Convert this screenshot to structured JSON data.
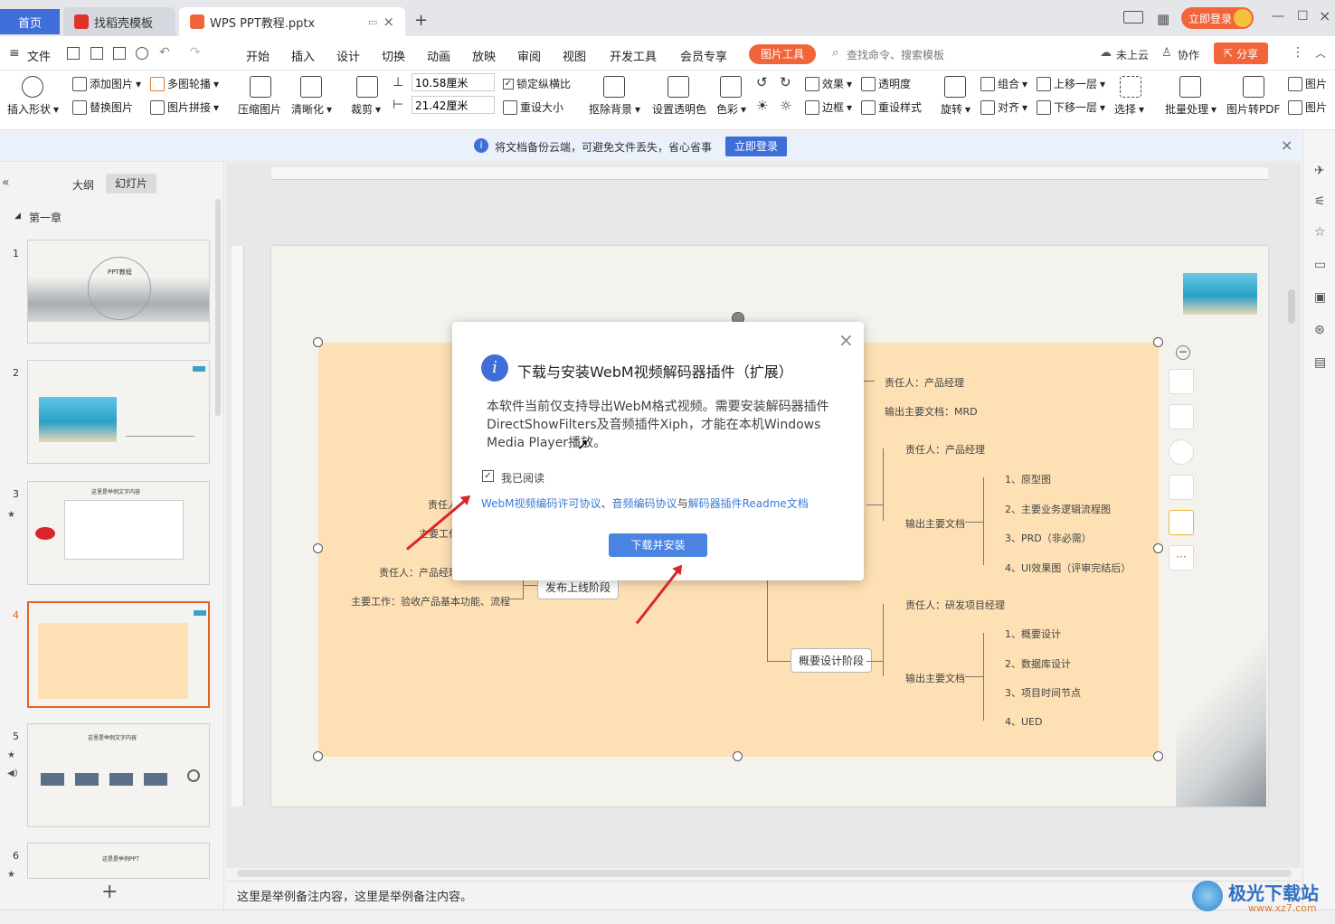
{
  "tabs": {
    "home": "首页",
    "find_template": "找稻壳模板",
    "document": "WPS PPT教程.pptx",
    "new_tab": "+"
  },
  "titlebar": {
    "login_button": "立即登录"
  },
  "menubar": {
    "file": "文件",
    "items": [
      "开始",
      "插入",
      "设计",
      "切换",
      "动画",
      "放映",
      "审阅",
      "视图",
      "开发工具",
      "会员专享"
    ],
    "picture_tools": "图片工具",
    "search_placeholder": "查找命令、搜索模板",
    "cloud": "未上云",
    "collab": "协作",
    "share": "分享"
  },
  "ribbon": {
    "insert_shape": "插入形状",
    "add_picture": "添加图片",
    "multi_carousel": "多图轮播",
    "replace_picture": "替换图片",
    "picture_stitch": "图片拼接",
    "compress": "压缩图片",
    "sharpen": "清晰化",
    "crop": "裁剪",
    "height_value": "10.58厘米",
    "width_value": "21.42厘米",
    "lock_ratio": "锁定纵横比",
    "reset_size": "重设大小",
    "remove_bg": "抠除背景",
    "set_transparent": "设置透明色",
    "color": "色彩",
    "effect": "效果",
    "transparency": "透明度",
    "border": "边框",
    "reset_style": "重设样式",
    "rotate": "旋转",
    "group": "组合",
    "align": "对齐",
    "bring_forward": "上移一层",
    "send_backward": "下移一层",
    "select": "选择",
    "batch": "批量处理",
    "to_pdf": "图片转PDF",
    "picture": "图片"
  },
  "infobar": {
    "message": "将文档备份云端，可避免文件丢失，省心省事",
    "login": "立即登录"
  },
  "leftpanel": {
    "outline": "大纲",
    "slides": "幻灯片",
    "section": "第一章",
    "slide_numbers": [
      "1",
      "2",
      "3",
      "4",
      "5",
      "6"
    ],
    "thumb1_title": "PPT教程",
    "thumb3_title": "这里是举例文字内容",
    "thumb5_title": "这里是举例文字内容",
    "thumb6_title": "这是是举例PPT",
    "add": "+"
  },
  "mindmap": {
    "left_labels": [
      "责任人",
      "主要工作",
      "责任人：产品经理",
      "主要工作：验收产品基本功能、流程"
    ],
    "release_stage": "发布上线阶段",
    "top_right": [
      "责任人：产品经理",
      "输出主要文档：MRD"
    ],
    "mid_owner": "责任人：产品经理",
    "mid_output": "输出主要文档",
    "mid_items": [
      "1、原型图",
      "2、主要业务逻辑流程图",
      "3、PRD（非必需）",
      "4、UI效果图（评审完结后）"
    ],
    "design_stage": "概要设计阶段",
    "bot_owner": "责任人：研发项目经理",
    "bot_output": "输出主要文档",
    "bot_items": [
      "1、概要设计",
      "2、数据库设计",
      "3、项目时间节点",
      "4、UED"
    ]
  },
  "dialog": {
    "title": "下载与安装WebM视频解码器插件（扩展）",
    "body": "本软件当前仅支持导出WebM格式视频。需要安装解码器插件DirectShowFilters及音频插件Xiph，才能在本机Windows Media Player播放。",
    "checkbox_label": "我已阅读",
    "link1": "WebM视频编码许可协议",
    "sep1": "、",
    "link2": "音频编码协议",
    "sep2": "与",
    "link3": "解码器插件Readme文档",
    "button": "下载并安装"
  },
  "notes": {
    "text": "这里是举例备注内容，这里是举例备注内容。"
  },
  "watermark": {
    "brand": "极光下载站",
    "url": "www.xz7.com"
  },
  "colors": {
    "accent": "#3f6ed8",
    "picture_tools": "#f2653a",
    "share": "#f2653a",
    "slide_bg": "#fde0b4",
    "link": "#3a7bd5",
    "arrow": "#d9262b"
  }
}
